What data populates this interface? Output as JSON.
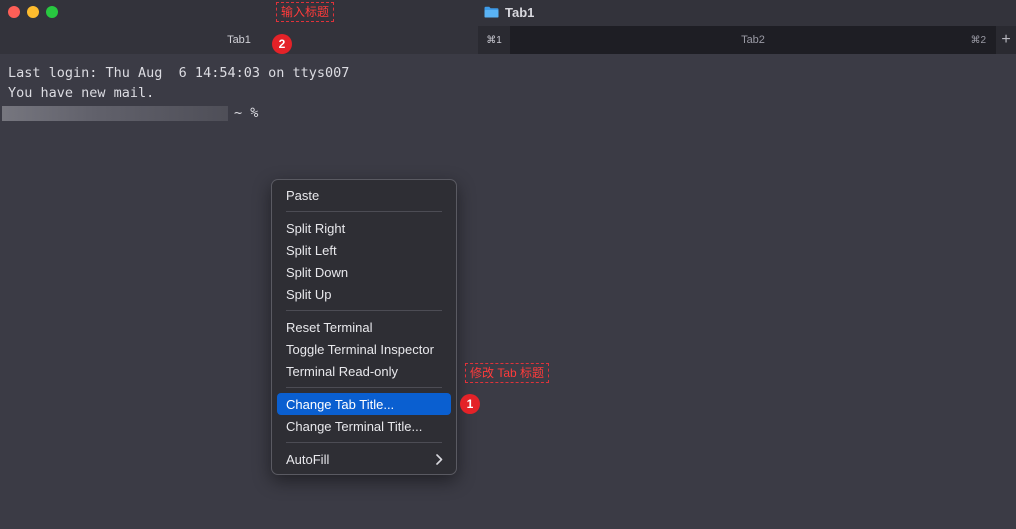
{
  "window": {
    "title": "Tab1"
  },
  "tabs": {
    "active": {
      "label": "Tab1",
      "shortcut": "⌘1"
    },
    "inactive": {
      "label": "Tab2",
      "shortcut": "⌘2"
    },
    "new_tab_label": "+"
  },
  "annotations": {
    "top": {
      "text": "输入标题",
      "number": "2"
    },
    "menu": {
      "text": "修改 Tab 标题",
      "number": "1"
    }
  },
  "terminal": {
    "lines": [
      "Last login: Thu Aug  6 14:54:03 on ttys007",
      "You have new mail."
    ],
    "prompt_suffix": "~ %"
  },
  "context_menu": {
    "groups": [
      [
        "Paste"
      ],
      [
        "Split Right",
        "Split Left",
        "Split Down",
        "Split Up"
      ],
      [
        "Reset Terminal",
        "Toggle Terminal Inspector",
        "Terminal Read-only"
      ],
      [
        "Change Tab Title...",
        "Change Terminal Title..."
      ],
      [
        "AutoFill"
      ]
    ],
    "highlighted": "Change Tab Title..."
  },
  "colors": {
    "background": "#3b3b45",
    "menu_highlight": "#0a5fd0",
    "annotation_red": "#e42228"
  },
  "icons": {
    "window_title": "folder-icon",
    "autofill": "chevron-right-icon"
  }
}
